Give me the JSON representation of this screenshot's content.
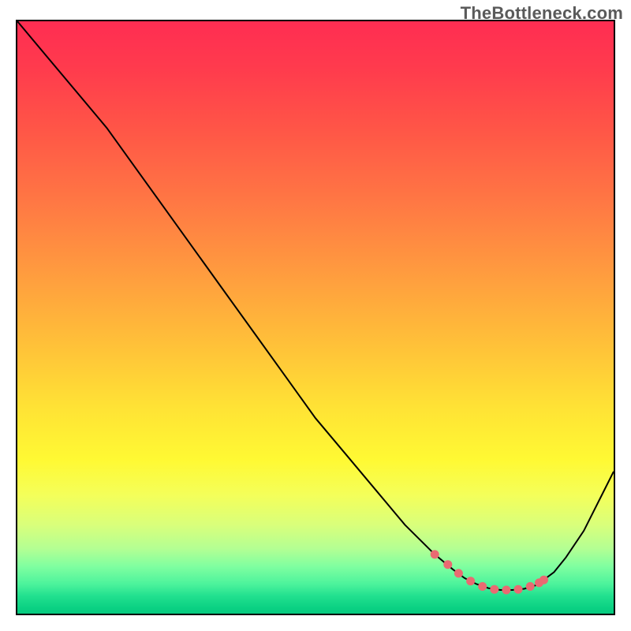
{
  "watermark": "TheBottleneck.com",
  "chart_data": {
    "type": "line",
    "title": "",
    "xlabel": "",
    "ylabel": "",
    "xlim": [
      0,
      100
    ],
    "ylim": [
      0,
      100
    ],
    "grid": false,
    "legend": false,
    "notes": "Background shows a vertical red→yellow→green gradient. Curve is a V-shape with minimum around x≈80. Lower y is better (green). Salmon dots highlight points near the minimum.",
    "series": [
      {
        "name": "curve",
        "x": [
          0,
          5,
          10,
          15,
          20,
          25,
          30,
          35,
          40,
          45,
          50,
          55,
          60,
          65,
          70,
          73,
          75,
          77,
          79,
          81,
          83,
          85,
          87,
          88,
          90,
          92,
          95,
          100
        ],
        "values": [
          100,
          94,
          88,
          82,
          75,
          68,
          61,
          54,
          47,
          40,
          33,
          27,
          21,
          15,
          10,
          7.5,
          6.0,
          5.0,
          4.3,
          4.0,
          4.0,
          4.2,
          4.8,
          5.5,
          7.0,
          9.5,
          14,
          24
        ]
      }
    ],
    "highlight_dots": {
      "name": "optimum-region",
      "color": "#e96a72",
      "x": [
        70,
        72.2,
        74.0,
        76.0,
        78.0,
        80.0,
        82.0,
        84.0,
        86.0,
        87.5,
        88.3
      ],
      "values": [
        10.0,
        8.3,
        6.8,
        5.5,
        4.6,
        4.1,
        4.0,
        4.1,
        4.6,
        5.2,
        5.7
      ]
    }
  }
}
